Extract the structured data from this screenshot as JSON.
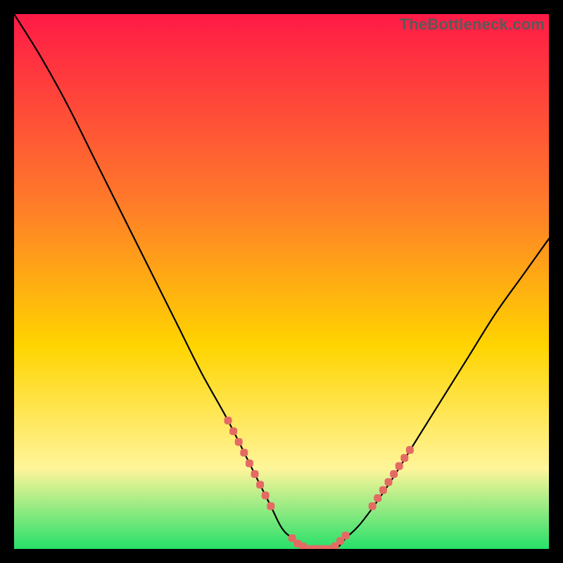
{
  "watermark": "TheBottleneck.com",
  "colors": {
    "background": "#000000",
    "gradient_top": "#ff1a47",
    "gradient_mid1": "#ff7a2a",
    "gradient_mid2": "#ffd400",
    "gradient_mid3": "#fff59a",
    "gradient_bottom": "#27e06a",
    "curve": "#000000",
    "marker": "#e46a63"
  },
  "chart_data": {
    "type": "line",
    "title": "",
    "xlabel": "",
    "ylabel": "",
    "xlim": [
      0,
      100
    ],
    "ylim": [
      0,
      100
    ],
    "series": [
      {
        "name": "bottleneck-curve",
        "x": [
          0,
          5,
          10,
          15,
          20,
          25,
          30,
          35,
          40,
          45,
          48,
          50,
          52,
          55,
          57,
          60,
          62,
          65,
          70,
          75,
          80,
          85,
          90,
          95,
          100
        ],
        "y": [
          100,
          92,
          83,
          73,
          63,
          53,
          43,
          33,
          24,
          14,
          8,
          4,
          2,
          0,
          0,
          0,
          2,
          5,
          12,
          20,
          28,
          36,
          44,
          51,
          58
        ]
      }
    ],
    "markers": [
      {
        "name": "left-cluster",
        "points": [
          {
            "x": 40,
            "y": 24
          },
          {
            "x": 41,
            "y": 22
          },
          {
            "x": 42,
            "y": 20
          },
          {
            "x": 43,
            "y": 18
          },
          {
            "x": 44,
            "y": 16
          },
          {
            "x": 45,
            "y": 14
          },
          {
            "x": 46,
            "y": 12
          },
          {
            "x": 47,
            "y": 10
          },
          {
            "x": 48,
            "y": 8
          }
        ]
      },
      {
        "name": "bottom-cluster",
        "points": [
          {
            "x": 52,
            "y": 2
          },
          {
            "x": 53,
            "y": 1
          },
          {
            "x": 54,
            "y": 0.5
          },
          {
            "x": 55,
            "y": 0
          },
          {
            "x": 56,
            "y": 0
          },
          {
            "x": 57,
            "y": 0
          },
          {
            "x": 58,
            "y": 0
          },
          {
            "x": 59,
            "y": 0
          },
          {
            "x": 60,
            "y": 0.5
          },
          {
            "x": 61,
            "y": 1.5
          },
          {
            "x": 62,
            "y": 2.5
          }
        ]
      },
      {
        "name": "right-cluster",
        "points": [
          {
            "x": 67,
            "y": 8
          },
          {
            "x": 68,
            "y": 9.5
          },
          {
            "x": 69,
            "y": 11
          },
          {
            "x": 70,
            "y": 12.5
          },
          {
            "x": 71,
            "y": 14
          },
          {
            "x": 72,
            "y": 15.5
          },
          {
            "x": 73,
            "y": 17
          },
          {
            "x": 74,
            "y": 18.5
          }
        ]
      }
    ]
  }
}
